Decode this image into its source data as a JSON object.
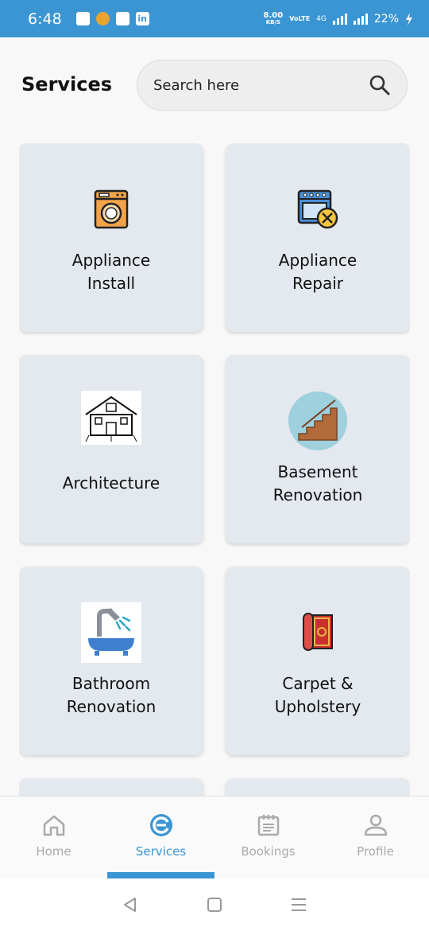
{
  "status_bar": {
    "time": "6:48",
    "speed_top": "8.00",
    "speed_bottom": "KB/S",
    "volte": "VoLTE",
    "network": "4G",
    "battery": "22%"
  },
  "header": {
    "title": "Services",
    "search_placeholder": "Search here"
  },
  "services": [
    {
      "label": "Appliance\nInstall",
      "icon": "washing-machine-icon"
    },
    {
      "label": "Appliance\nRepair",
      "icon": "oven-repair-icon"
    },
    {
      "label": "Architecture",
      "icon": "house-drawing-icon"
    },
    {
      "label": "Basement\nRenovation",
      "icon": "stairs-icon"
    },
    {
      "label": "Bathroom\nRenovation",
      "icon": "bathtub-icon"
    },
    {
      "label": "Carpet &\nUpholstery",
      "icon": "carpet-roll-icon"
    }
  ],
  "bottom_nav": [
    {
      "label": "Home",
      "icon": "home-icon",
      "active": false
    },
    {
      "label": "Services",
      "icon": "services-logo-icon",
      "active": true
    },
    {
      "label": "Bookings",
      "icon": "calendar-icon",
      "active": false
    },
    {
      "label": "Profile",
      "icon": "profile-icon",
      "active": false
    }
  ],
  "colors": {
    "accent": "#3b95d3",
    "card_bg": "#e3e9ee",
    "inactive": "#aaaaaa"
  }
}
